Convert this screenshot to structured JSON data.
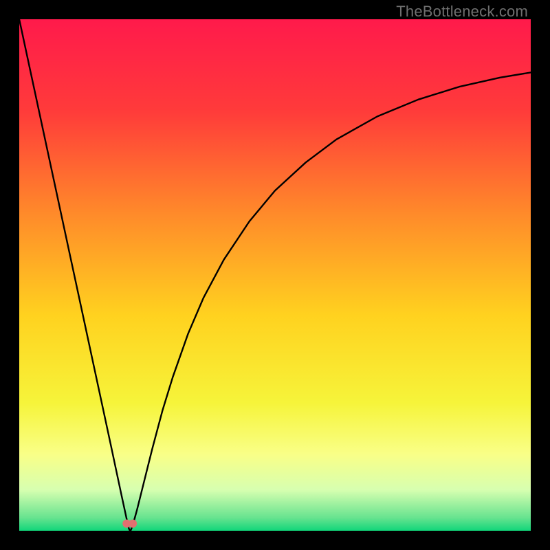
{
  "watermark": "TheBottleneck.com",
  "chart_data": {
    "type": "line",
    "title": "",
    "xlabel": "",
    "ylabel": "",
    "xlim": [
      0,
      100
    ],
    "ylim": [
      0,
      100
    ],
    "background_gradient": {
      "stops": [
        {
          "offset": 0.0,
          "color": "#ff1a4b"
        },
        {
          "offset": 0.18,
          "color": "#ff3b3a"
        },
        {
          "offset": 0.38,
          "color": "#ff8a2a"
        },
        {
          "offset": 0.58,
          "color": "#ffd21f"
        },
        {
          "offset": 0.75,
          "color": "#f6f43a"
        },
        {
          "offset": 0.85,
          "color": "#f9ff87"
        },
        {
          "offset": 0.92,
          "color": "#d7ffb0"
        },
        {
          "offset": 0.975,
          "color": "#66e38f"
        },
        {
          "offset": 1.0,
          "color": "#11d67a"
        }
      ]
    },
    "series": [
      {
        "name": "bottleneck-curve",
        "stroke": "#000000",
        "x": [
          0,
          2,
          4,
          6,
          8,
          10,
          12,
          14,
          16,
          18,
          19,
          20,
          20.5,
          21,
          21.4,
          21.6,
          21.8,
          22,
          22.2,
          22.5,
          23,
          24,
          25,
          26,
          28,
          30,
          33,
          36,
          40,
          45,
          50,
          56,
          62,
          70,
          78,
          86,
          94,
          100
        ],
        "y": [
          100,
          90.7,
          81.4,
          72.1,
          62.8,
          53.5,
          44.2,
          34.9,
          25.6,
          16.3,
          11.6,
          6.9,
          4.6,
          2.3,
          0.5,
          0.1,
          0.1,
          0.6,
          1.2,
          2.2,
          4.0,
          8.0,
          12.0,
          16.0,
          23.5,
          30.0,
          38.5,
          45.5,
          53.0,
          60.5,
          66.5,
          72.0,
          76.5,
          81.0,
          84.3,
          86.8,
          88.6,
          89.6
        ]
      }
    ],
    "markers": [
      {
        "name": "min-marker-1",
        "x": 21.0,
        "y": 1.4,
        "color": "#e17070",
        "r": 6
      },
      {
        "name": "min-marker-2",
        "x": 22.2,
        "y": 1.4,
        "color": "#e17070",
        "r": 6
      }
    ]
  }
}
